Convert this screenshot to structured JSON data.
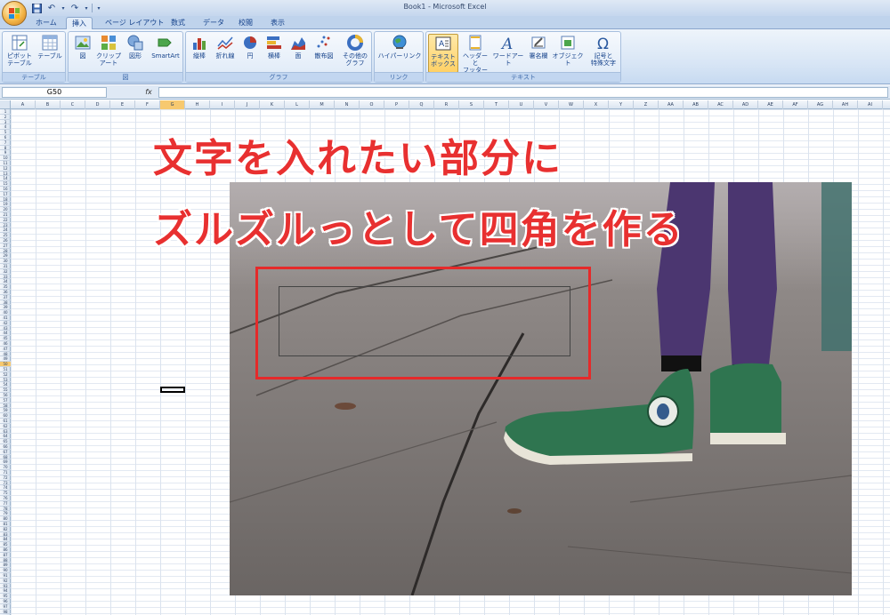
{
  "window": {
    "title": "Book1 - Microsoft Excel"
  },
  "quick_access": {
    "save_icon": "save-icon",
    "undo_icon": "undo-icon",
    "redo_icon": "redo-icon",
    "customize_icon": "qat-customize-icon",
    "undo_glyph": "↶",
    "redo_glyph": "↷",
    "more_glyph": "▾"
  },
  "tabs": [
    {
      "label": "ホーム",
      "active": false
    },
    {
      "label": "挿入",
      "active": true
    },
    {
      "label": "ページ レイアウト",
      "active": false
    },
    {
      "label": "数式",
      "active": false
    },
    {
      "label": "データ",
      "active": false
    },
    {
      "label": "校閲",
      "active": false
    },
    {
      "label": "表示",
      "active": false
    }
  ],
  "ribbon": {
    "groups": {
      "table": {
        "label": "テーブル",
        "pivot": "ピボット\nテーブル",
        "table": "テーブル"
      },
      "illustrations": {
        "label": "図",
        "picture": "図",
        "clipart": "クリップ\nアート",
        "shapes": "図形",
        "smartart": "SmartArt"
      },
      "charts": {
        "label": "グラフ",
        "column": "縦棒",
        "line": "折れ線",
        "pie": "円",
        "bar": "横棒",
        "area": "面",
        "scatter": "散布図",
        "other": "その他の\nグラフ"
      },
      "links": {
        "label": "リンク",
        "hyperlink": "ハイパーリンク"
      },
      "text": {
        "label": "テキスト",
        "textbox": "テキスト\nボックス",
        "headerfooter": "ヘッダーと\nフッター",
        "wordart": "ワードアート",
        "signature": "署名欄",
        "object": "オブジェクト",
        "symbol": "記号と\n特殊文字"
      }
    }
  },
  "formula_bar": {
    "name_box": "G50",
    "fx": "fx",
    "formula": ""
  },
  "grid": {
    "columns": [
      "A",
      "B",
      "C",
      "D",
      "E",
      "F",
      "G",
      "H",
      "I",
      "J",
      "K",
      "L",
      "M",
      "N",
      "O",
      "P",
      "Q",
      "R",
      "S",
      "T",
      "U",
      "V",
      "W",
      "X",
      "Y",
      "Z",
      "AA",
      "AB",
      "AC",
      "AD",
      "AE",
      "AF",
      "AG",
      "AH",
      "AI"
    ],
    "selected_column": "G",
    "row_count": 98,
    "selected_row": 50
  },
  "annotation": {
    "line1": "文字を入れたい部分に",
    "line2": "ズルズルっとして四角を作る",
    "color": "#e83030"
  }
}
